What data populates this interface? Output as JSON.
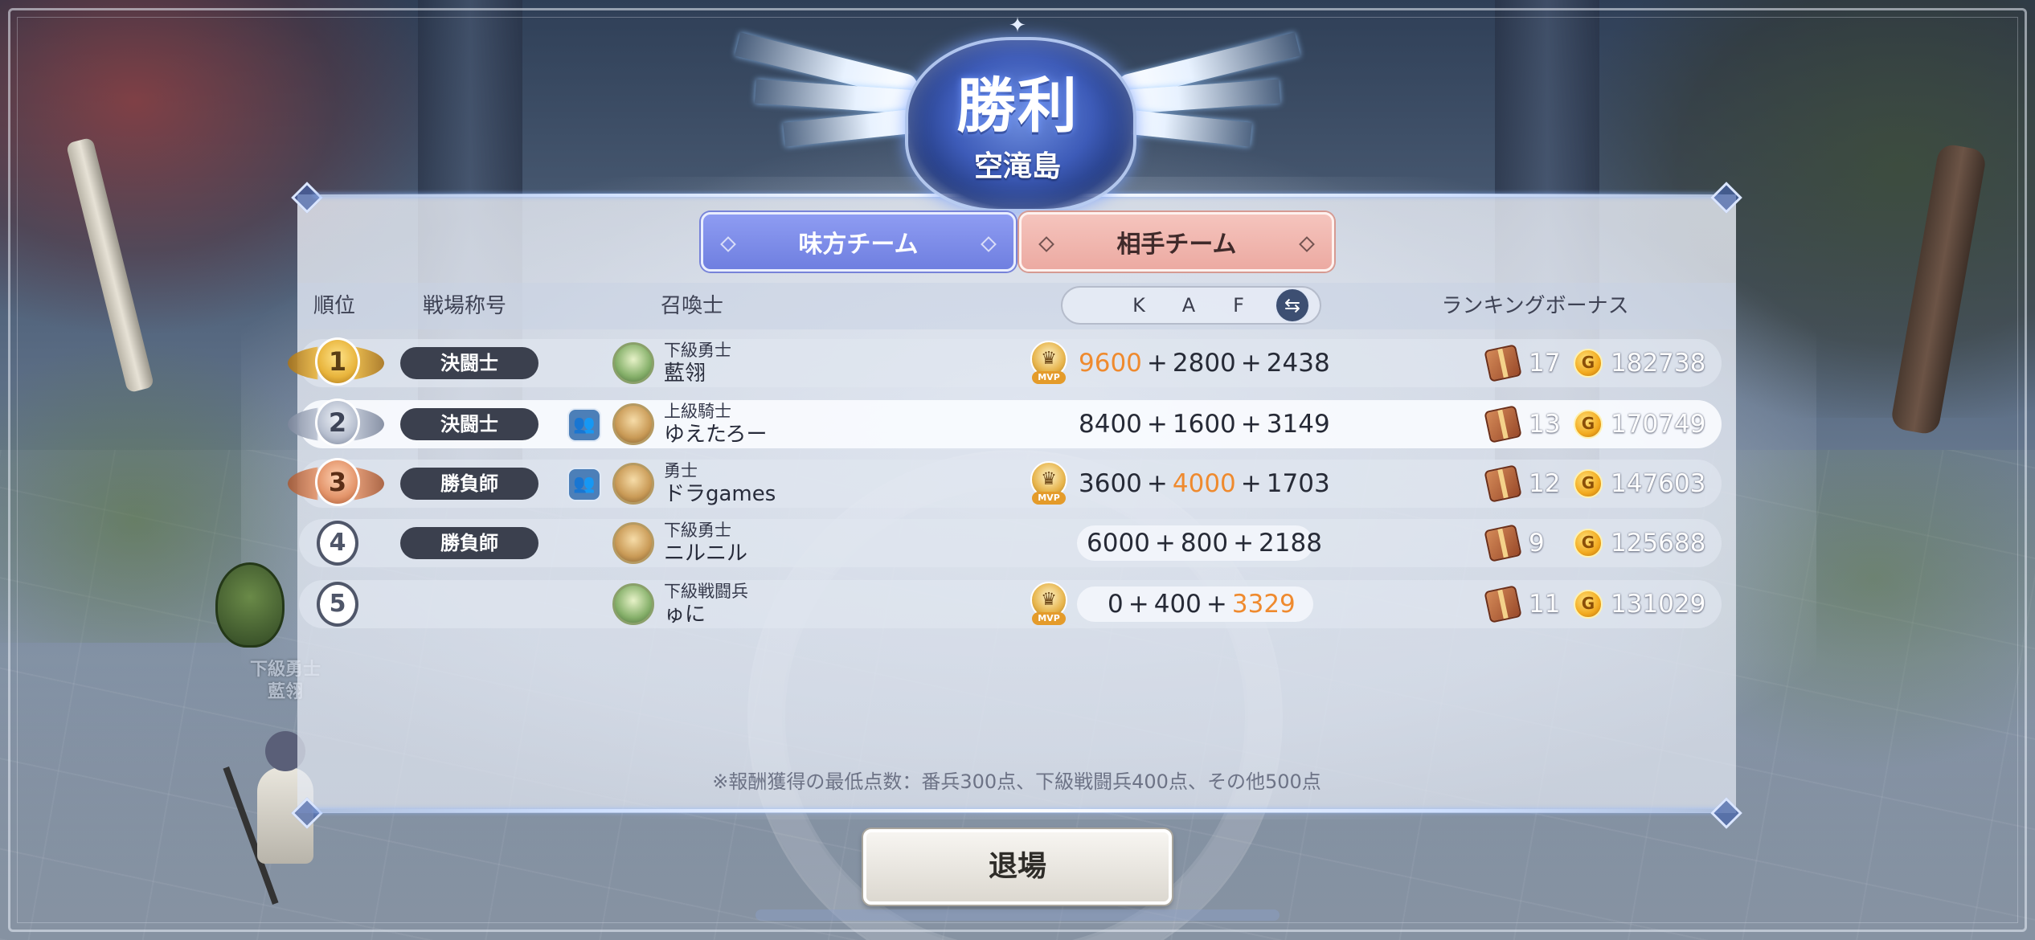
{
  "result": {
    "title": "勝利",
    "stage": "空滝島"
  },
  "tabs": {
    "ally": "味方チーム",
    "enemy": "相手チーム"
  },
  "headers": {
    "rank": "順位",
    "title": "戦場称号",
    "summoner": "召喚士",
    "k": "K",
    "a": "A",
    "f": "F",
    "bonus": "ランキングボーナス"
  },
  "rows": [
    {
      "rank": "1",
      "badge": "決闘士",
      "rank_name": "下級勇士",
      "name": "藍翎",
      "mvp": true,
      "k": "9600",
      "a": "2800",
      "f": "2438",
      "highlight": "k",
      "chests": "17",
      "coins": "182738"
    },
    {
      "rank": "2",
      "badge": "決闘士",
      "rank_name": "上級騎士",
      "name": "ゆえたろー",
      "mvp": false,
      "k": "8400",
      "a": "1600",
      "f": "3149",
      "highlight": "",
      "chests": "13",
      "coins": "170749"
    },
    {
      "rank": "3",
      "badge": "勝負師",
      "rank_name": "勇士",
      "name": "ドラgames",
      "mvp": true,
      "k": "3600",
      "a": "4000",
      "f": "1703",
      "highlight": "a",
      "chests": "12",
      "coins": "147603"
    },
    {
      "rank": "4",
      "badge": "勝負師",
      "rank_name": "下級勇士",
      "name": "ニルニル",
      "mvp": false,
      "k": "6000",
      "a": "800",
      "f": "2188",
      "highlight": "",
      "chests": "9",
      "coins": "125688"
    },
    {
      "rank": "5",
      "badge": "",
      "rank_name": "下級戦闘兵",
      "name": "ゅに",
      "mvp": true,
      "k": "0",
      "a": "400",
      "f": "3329",
      "highlight": "f",
      "chests": "11",
      "coins": "131029"
    }
  ],
  "plus": "+",
  "mvp_label": "MVP",
  "note": "※報酬獲得の最低点数：番兵300点、下級戦闘兵400点、その他500点",
  "exit": "退場",
  "player_tag": {
    "rank_name": "下級勇士",
    "name": "藍翎"
  },
  "colors": {
    "accent_orange": "#ef8a2e",
    "ally_tab": "#7f8deb",
    "enemy_tab": "#f0b7b0",
    "badge": "#3b404e"
  },
  "icons": {
    "chest": "treasure-chest-icon",
    "coin": "gold-coin-icon",
    "mvp": "mvp-crown-icon",
    "swap": "swap-arrows-icon",
    "group": "party-icon"
  }
}
